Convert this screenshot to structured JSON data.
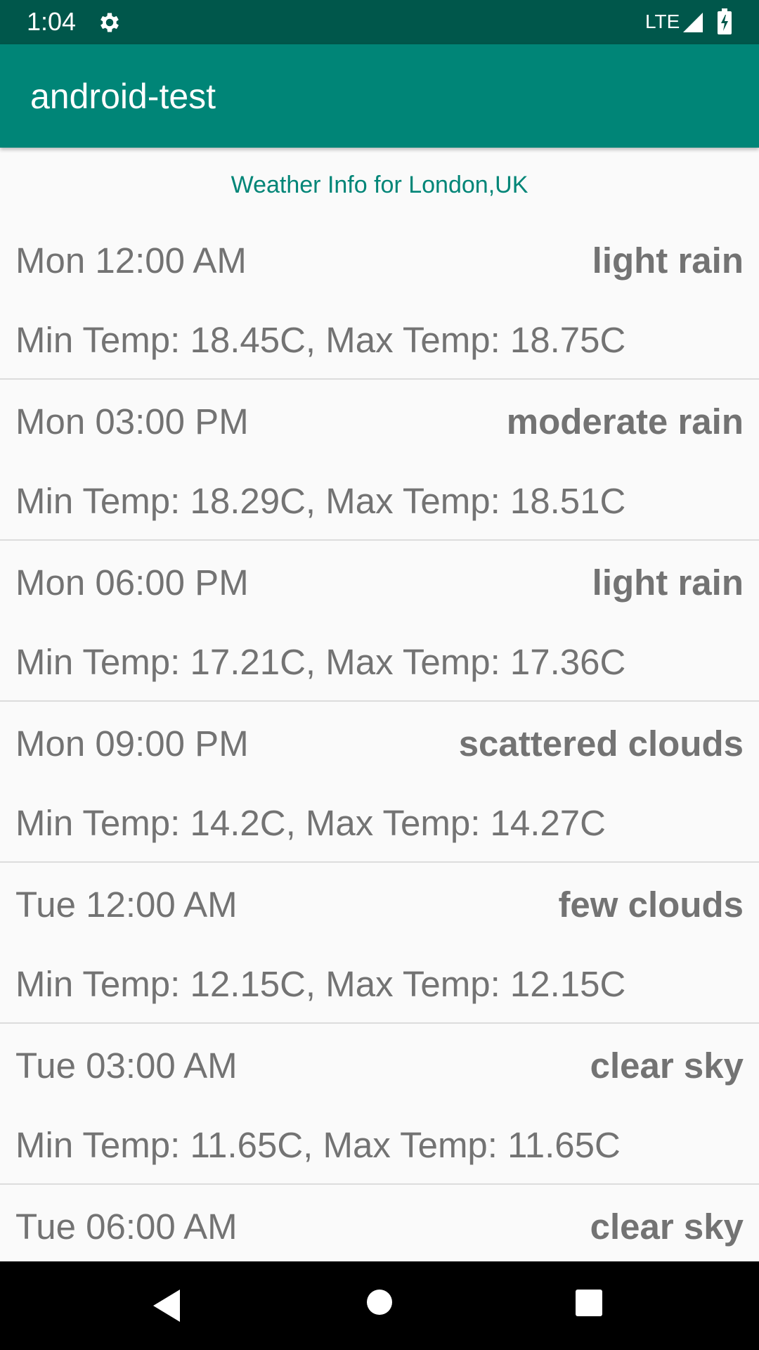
{
  "status_bar": {
    "time": "1:04",
    "network": "LTE",
    "icons": [
      "gear-icon",
      "signal-icon",
      "battery-charging-icon"
    ]
  },
  "app_bar": {
    "title": "android-test"
  },
  "subtitle": "Weather Info for London,UK",
  "forecast": [
    {
      "time": "Mon 12:00 AM",
      "description": "light rain",
      "temps": "Min Temp: 18.45C, Max Temp: 18.75C"
    },
    {
      "time": "Mon 03:00 PM",
      "description": "moderate rain",
      "temps": "Min Temp: 18.29C, Max Temp: 18.51C"
    },
    {
      "time": "Mon 06:00 PM",
      "description": "light rain",
      "temps": "Min Temp: 17.21C, Max Temp: 17.36C"
    },
    {
      "time": "Mon 09:00 PM",
      "description": "scattered clouds",
      "temps": "Min Temp: 14.2C, Max Temp: 14.27C"
    },
    {
      "time": "Tue 12:00 AM",
      "description": "few clouds",
      "temps": "Min Temp: 12.15C, Max Temp: 12.15C"
    },
    {
      "time": "Tue 03:00 AM",
      "description": "clear sky",
      "temps": "Min Temp: 11.65C, Max Temp: 11.65C"
    },
    {
      "time": "Tue 06:00 AM",
      "description": "clear sky",
      "temps": ""
    }
  ],
  "nav_bar": {
    "icons": [
      "back-icon",
      "home-icon",
      "recents-icon"
    ]
  },
  "colors": {
    "status_bar": "#00574b",
    "app_bar": "#008577",
    "accent": "#008577",
    "text": "#737373",
    "background": "#fafafa"
  }
}
